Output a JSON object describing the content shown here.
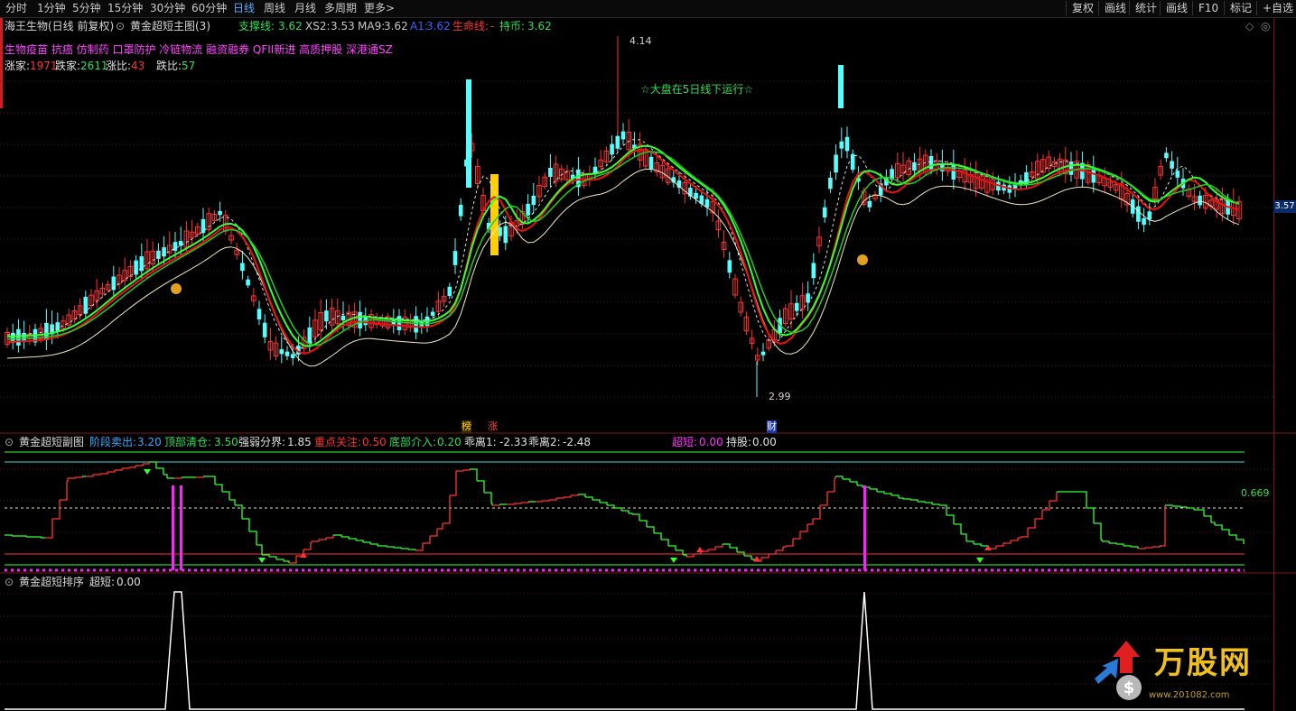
{
  "topbar": {
    "timeframes": [
      "分时",
      "1分钟",
      "5分钟",
      "15分钟",
      "30分钟",
      "60分钟",
      "日线",
      "周线",
      "月线",
      "多周期",
      "更多>"
    ],
    "active_timeframe": "日线",
    "right_buttons": [
      "复权",
      "画线",
      "统计",
      "画线",
      "F10",
      "标记",
      "+自选"
    ]
  },
  "main": {
    "title": "海王生物(日线 前复权)",
    "indicator_name": "黄金超短主图(3)",
    "legend": [
      {
        "label": "支撑线:",
        "value": "3.62",
        "color": "#33dd55"
      },
      {
        "label": "XS2:",
        "value": "3.53",
        "color": "#c8c8c8"
      },
      {
        "label": "MA9:",
        "value": "3.62",
        "color": "#c8c8c8"
      },
      {
        "label": "A1:",
        "value": "3.62",
        "color": "#3366ff"
      },
      {
        "label": "生命线:",
        "value": "-",
        "color": "#ff3333"
      },
      {
        "label": "持币:",
        "value": "3.62",
        "color": "#33dd55"
      }
    ],
    "concepts": "生物疫苗 抗癌 仿制药 口罩防护 冷链物流 融资融券 QFII新进 高质押股 深港通SZ",
    "breadth": [
      {
        "label": "涨家:",
        "value": "1971"
      },
      {
        "label": "跌家:",
        "value": "2611"
      },
      {
        "label": "涨比:",
        "value": "43"
      },
      {
        "label": "跌比:",
        "value": "57"
      }
    ],
    "high_label": "4.14",
    "low_label": "2.99",
    "annotation": "☆大盘在5日线下运行☆",
    "price_badge": "3.57",
    "event_markers": [
      "榜",
      "涨",
      "财"
    ]
  },
  "sub1": {
    "indicator_name": "黄金超短副图",
    "legend": [
      {
        "label": "阶段卖出:",
        "value": "3.20",
        "color": "#33aaff"
      },
      {
        "label": "顶部清仓:",
        "value": "3.50",
        "color": "#33dd55"
      },
      {
        "label": "强弱分界:",
        "value": "1.85",
        "color": "#e0e0e0"
      },
      {
        "label": "重点关注:",
        "value": "0.50",
        "color": "#ff3333"
      },
      {
        "label": "底部介入:",
        "value": "0.20",
        "color": "#33dd55"
      },
      {
        "label": "乖离1:",
        "value": "-2.33",
        "color": "#e0e0e0"
      },
      {
        "label": "乖离2:",
        "value": "-2.48",
        "color": "#e0e0e0"
      }
    ],
    "legend2": [
      {
        "label": "超短:",
        "value": "0.00",
        "color": "#ff33ff"
      },
      {
        "label": "持股:",
        "value": "0.00",
        "color": "#e0e0e0"
      }
    ],
    "level_label": "0.669"
  },
  "sub2": {
    "indicator_name": "黄金超短排序",
    "legend_label": "超短:",
    "legend_value": "0.00"
  },
  "watermark": {
    "brand": "万股网",
    "url": "www.201082.com"
  },
  "colors": {
    "up": "#ff3333",
    "down": "#54ffff",
    "green_line": "#33ff33",
    "magenta": "#ff22ff",
    "yellow": "#ffd000"
  }
}
